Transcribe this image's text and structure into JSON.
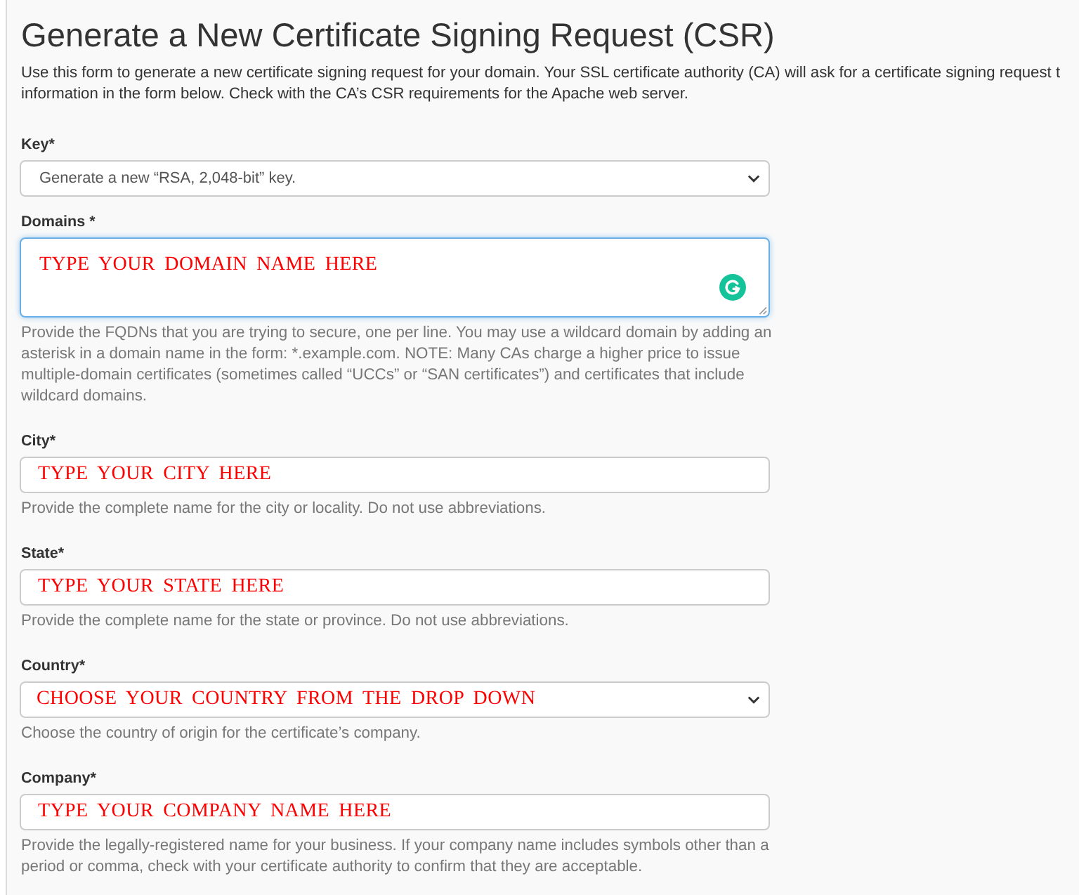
{
  "title": "Generate a New Certificate Signing Request (CSR)",
  "intro": "Use this form to generate a new certificate signing request for your domain. Your SSL certificate authority (CA) will ask for a certificate signing request t\ninformation in the form below. Check with the CA’s CSR requirements for the Apache web server.",
  "fields": [
    {
      "kind": "select",
      "label": "Key*",
      "value": "Generate a new “RSA, 2,048-bit” key.",
      "focused": false
    },
    {
      "kind": "textarea",
      "label": "Domains *",
      "annotation": "TYPE YOUR DOMAIN NAME HERE",
      "focused": true,
      "help": "Provide the FQDNs that you are trying to secure, one per line. You may use a wildcard domain by adding an asterisk in a domain name in the form: *.example.com. NOTE: Many CAs charge a higher price to issue multiple-domain certificates (sometimes called “UCCs” or “SAN certificates”) and certificates that include wildcard domains."
    },
    {
      "kind": "input",
      "label": "City*",
      "annotation": "TYPE YOUR CITY HERE",
      "focused": false,
      "help": "Provide the complete name for the city or locality. Do not use abbreviations."
    },
    {
      "kind": "input",
      "label": "State*",
      "annotation": "TYPE YOUR STATE HERE",
      "focused": false,
      "help": "Provide the complete name for the state or province. Do not use abbreviations."
    },
    {
      "kind": "select",
      "label": "Country*",
      "annotation": "CHOOSE YOUR COUNTRY FROM THE DROP DOWN",
      "focused": false,
      "help": "Choose the country of origin for the certificate’s company."
    },
    {
      "kind": "input",
      "label": "Company*",
      "annotation": "TYPE YOUR COMPANY NAME HERE",
      "focused": false,
      "help": "Provide the legally-registered name for your business. If your company name includes symbols other than a period or comma, check with your certificate authority to confirm that they are acceptable."
    }
  ]
}
